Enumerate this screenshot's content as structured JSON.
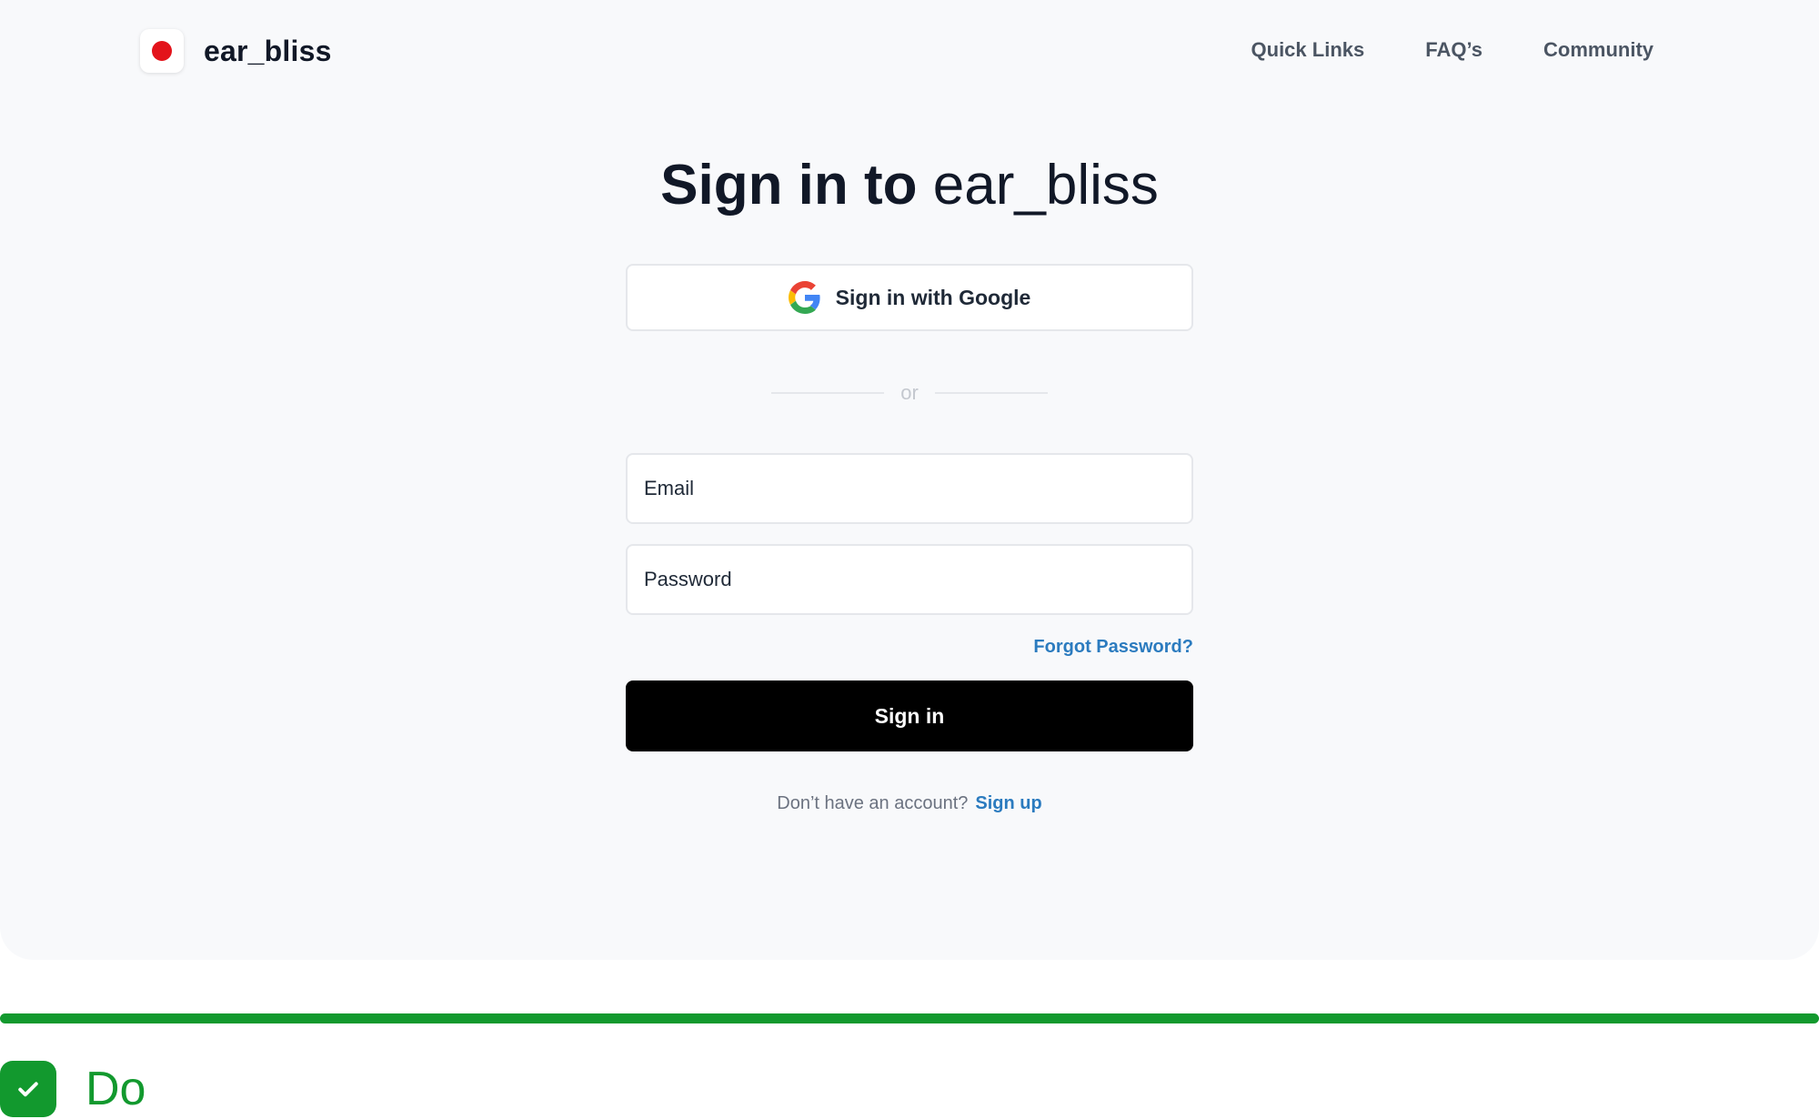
{
  "header": {
    "brand": "ear_bliss",
    "nav": [
      "Quick Links",
      "FAQ’s",
      "Community"
    ]
  },
  "title": {
    "bold": "Sign in to",
    "light": "ear_bliss"
  },
  "google_button": {
    "label": "Sign in with Google",
    "icon": "google-g-icon"
  },
  "divider": {
    "text": "or"
  },
  "form": {
    "email_placeholder": "Email",
    "password_placeholder": "Password",
    "forgot_label": "Forgot Password?",
    "submit_label": "Sign in"
  },
  "signup": {
    "prompt": "Don’t have an account?",
    "link": "Sign up"
  },
  "footer": {
    "label": "Do",
    "icon": "checkmark-icon"
  },
  "colors": {
    "brand_dot": "#e3131b",
    "link": "#2b7bbf",
    "primary_button": "#000000",
    "do_green": "#12992e",
    "panel_bg": "#f8f9fb"
  }
}
